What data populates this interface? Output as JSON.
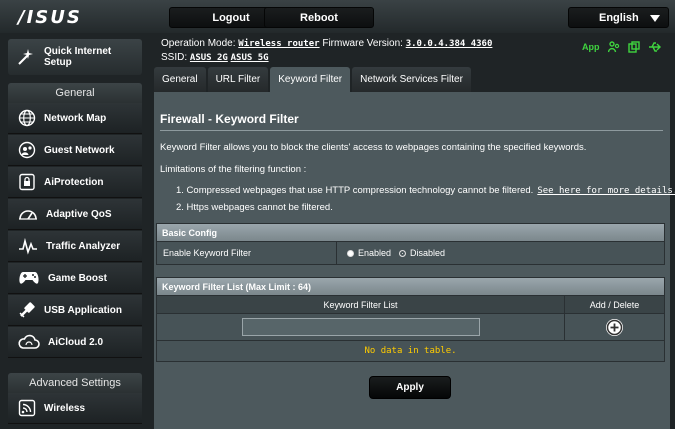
{
  "brand": {
    "logo": "/ISUS"
  },
  "topbar": {
    "logout": "Logout",
    "reboot": "Reboot",
    "language": "English"
  },
  "opinfo": {
    "mode_label": "Operation Mode:",
    "mode_value": "Wireless router",
    "fw_label": "Firmware Version:",
    "fw_value": "3.0.0.4.384_4360",
    "ssid_label": "SSID:",
    "ssid_2g": "ASUS_2G",
    "ssid_5g": "ASUS_5G"
  },
  "status": {
    "app": "App"
  },
  "sidebar": {
    "qis": {
      "line1": "Quick Internet",
      "line2": "Setup"
    },
    "general": "General",
    "items": [
      {
        "label": "Network Map",
        "icon": "network-map-icon"
      },
      {
        "label": "Guest Network",
        "icon": "guest-network-icon"
      },
      {
        "label": "AiProtection",
        "icon": "lock-icon"
      },
      {
        "label": "Adaptive QoS",
        "icon": "gauge-icon"
      },
      {
        "label": "Traffic Analyzer",
        "icon": "traffic-icon"
      },
      {
        "label": "Game Boost",
        "icon": "gamepad-icon"
      },
      {
        "label": "USB Application",
        "icon": "usb-icon"
      },
      {
        "label": "AiCloud 2.0",
        "icon": "cloud-icon"
      }
    ],
    "advanced": "Advanced Settings",
    "adv_items": [
      {
        "label": "Wireless",
        "icon": "wireless-icon"
      }
    ]
  },
  "tabs": [
    "General",
    "URL Filter",
    "Keyword Filter",
    "Network Services Filter"
  ],
  "page": {
    "title": "Firewall - Keyword Filter",
    "desc": "Keyword Filter allows you to block the clients' access to webpages containing the specified keywords.",
    "limits": "Limitations of the filtering function :",
    "limit1": "1. Compressed webpages that use HTTP compression technology cannot be filtered.",
    "limit1_link": "See here for more details.",
    "limit2": "2. Https webpages cannot be filtered."
  },
  "basic": {
    "header": "Basic Config",
    "enable_label": "Enable Keyword Filter",
    "enabled": "Enabled",
    "disabled": "Disabled"
  },
  "list": {
    "header": "Keyword Filter List (Max Limit : 64)",
    "col1": "Keyword Filter List",
    "col2": "Add / Delete",
    "input_value": "",
    "nodata": "No data in table."
  },
  "apply": "Apply"
}
